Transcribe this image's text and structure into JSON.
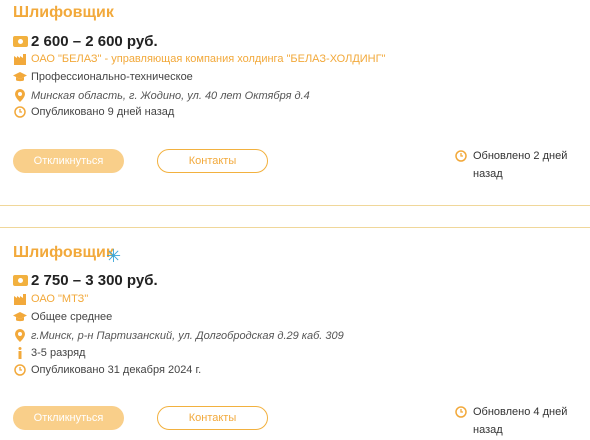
{
  "jobs": [
    {
      "title": "Шлифовщик",
      "salary": "2 600 – 2 600 руб.",
      "company": "ОАО \"БЕЛАЗ\" - управляющая компания холдинга \"БЕЛАЗ-ХОЛДИНГ\"",
      "education": "Профессионально-техническое",
      "address": "Минская область, г. Жодино, ул. 40 лет Октября д.4",
      "published": "Опубликовано 9 дней назад",
      "apply_label": "Откликнуться",
      "contacts_label": "Контакты",
      "updated": "Обновлено 2 дней назад"
    },
    {
      "title": "Шлифовщик",
      "salary": "2 750 – 3 300 руб.",
      "company": "ОАО \"МТЗ\"",
      "education": "Общее среднее",
      "address": "г.Минск, р-н Партизанский, ул. Долгобродская д.29 каб. 309",
      "rank": "3-5 разряд",
      "published": "Опубликовано 31 декабря 2024 г.",
      "apply_label": "Откликнуться",
      "contacts_label": "Контакты",
      "updated": "Обновлено 4 дней назад"
    }
  ],
  "icons": {
    "salary": "money-icon",
    "company": "factory-icon",
    "education": "graduation-cap-icon",
    "address": "location-pin-icon",
    "rank": "info-icon",
    "published": "clock-icon",
    "updated": "clock-icon",
    "featured": "asterisk-icon"
  },
  "colors": {
    "accent": "#f2a93b",
    "button_fill": "#f9cf8a",
    "divider": "#f0d79a",
    "featured": "#3aa6d8"
  }
}
